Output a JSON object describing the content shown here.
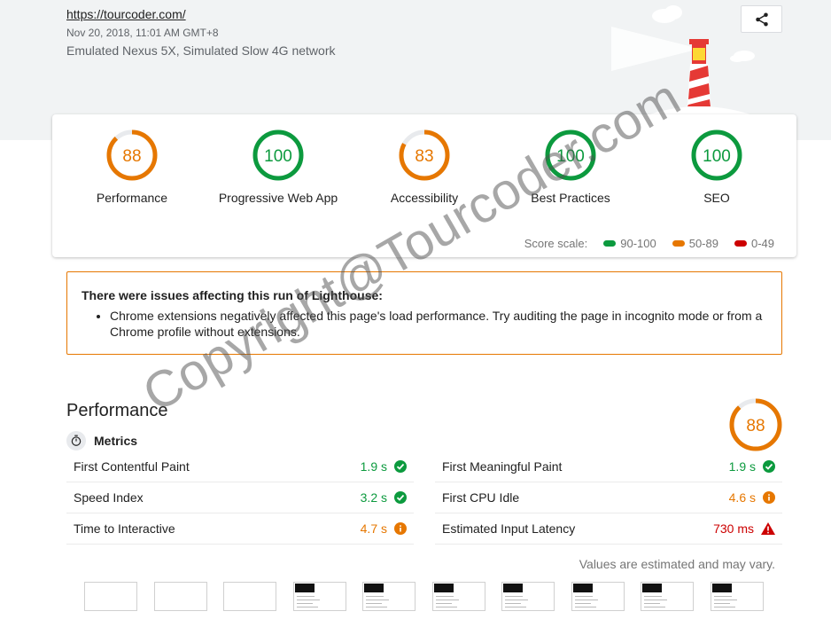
{
  "header": {
    "url": "https://tourcoder.com/",
    "date": "Nov 20, 2018, 11:01 AM GMT+8",
    "device": "Emulated Nexus 5X, Simulated Slow 4G network"
  },
  "colors": {
    "pass": "#0c9a3e",
    "average": "#e67700",
    "fail": "#cc0000"
  },
  "scores": [
    {
      "label": "Performance",
      "value": 88,
      "status": "average"
    },
    {
      "label": "Progressive Web App",
      "value": 100,
      "status": "pass"
    },
    {
      "label": "Accessibility",
      "value": 83,
      "status": "average"
    },
    {
      "label": "Best Practices",
      "value": 100,
      "status": "pass"
    },
    {
      "label": "SEO",
      "value": 100,
      "status": "pass"
    }
  ],
  "scale": {
    "label": "Score scale:",
    "ranges": [
      "90-100",
      "50-89",
      "0-49"
    ]
  },
  "warning": {
    "title": "There were issues affecting this run of Lighthouse:",
    "item": "Chrome extensions negatively affected this page's load performance. Try auditing the page in incognito mode or from a Chrome profile without extensions."
  },
  "performance": {
    "title": "Performance",
    "score": 88,
    "metrics_label": "Metrics",
    "left": [
      {
        "name": "First Contentful Paint",
        "value": "1.9 s",
        "status": "pass"
      },
      {
        "name": "Speed Index",
        "value": "3.2 s",
        "status": "pass"
      },
      {
        "name": "Time to Interactive",
        "value": "4.7 s",
        "status": "average"
      }
    ],
    "right": [
      {
        "name": "First Meaningful Paint",
        "value": "1.9 s",
        "status": "pass"
      },
      {
        "name": "First CPU Idle",
        "value": "4.6 s",
        "status": "average"
      },
      {
        "name": "Estimated Input Latency",
        "value": "730 ms",
        "status": "fail"
      }
    ],
    "note": "Values are estimated and may vary."
  },
  "icons": {
    "share": "share-icon",
    "clock": "stopwatch-icon",
    "pass": "check-circle-icon",
    "average": "info-circle-icon",
    "fail": "warning-triangle-icon"
  },
  "watermark": "Copyright@Tourcoder.com"
}
